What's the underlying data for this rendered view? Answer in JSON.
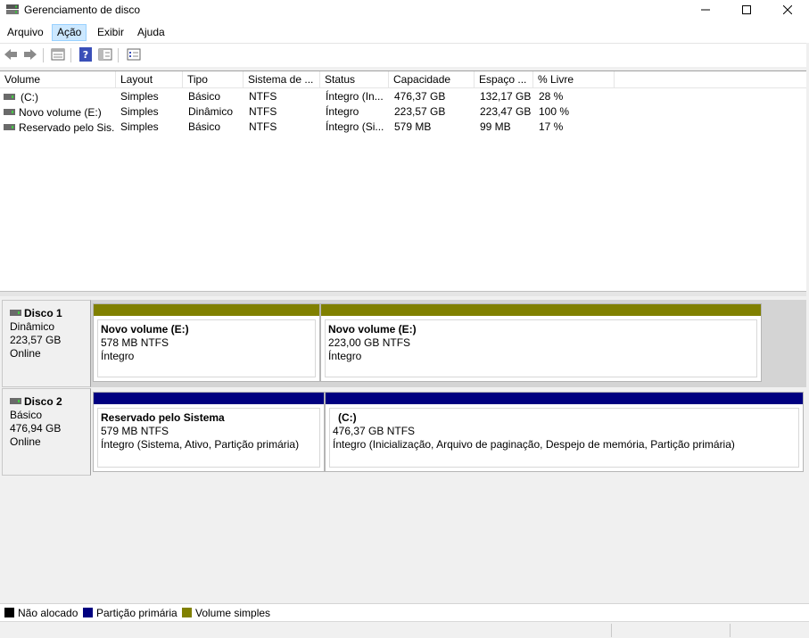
{
  "window": {
    "title": "Gerenciamento de disco",
    "controls": {
      "minimize": "—",
      "maximize": "☐",
      "close": "✕"
    }
  },
  "menu": [
    "Arquivo",
    "Ação",
    "Exibir",
    "Ajuda"
  ],
  "toolbar": [
    "back-icon",
    "forward-icon",
    "properties-icon",
    "help-icon",
    "show-hide-icon",
    "list-icon"
  ],
  "columns": [
    "Volume",
    "Layout",
    "Tipo",
    "Sistema de ...",
    "Status",
    "Capacidade",
    "Espaço ...",
    "% Livre"
  ],
  "volumes": [
    {
      "name": "(C:)",
      "layout": "Simples",
      "type": "Básico",
      "fs": "NTFS",
      "status": "Íntegro (In...",
      "capacity": "476,37 GB",
      "free": "132,17 GB",
      "pct": "28 %"
    },
    {
      "name": "Novo volume (E:)",
      "layout": "Simples",
      "type": "Dinâmico",
      "fs": "NTFS",
      "status": "Íntegro",
      "capacity": "223,57 GB",
      "free": "223,47 GB",
      "pct": "100 %"
    },
    {
      "name": "Reservado pelo Sis...",
      "layout": "Simples",
      "type": "Básico",
      "fs": "NTFS",
      "status": "Íntegro (Si...",
      "capacity": "579 MB",
      "free": "99 MB",
      "pct": "17 %"
    }
  ],
  "disks": [
    {
      "name": "Disco 1",
      "type": "Dinâmico",
      "size": "223,57 GB",
      "state": "Online",
      "partitions": [
        {
          "name": "Novo volume  (E:)",
          "size": "578 MB NTFS",
          "status": "Íntegro"
        },
        {
          "name": "Novo volume  (E:)",
          "size": "223,00 GB NTFS",
          "status": "Íntegro"
        }
      ]
    },
    {
      "name": "Disco 2",
      "type": "Básico",
      "size": "476,94 GB",
      "state": "Online",
      "partitions": [
        {
          "name": "Reservado pelo Sistema",
          "size": "579 MB NTFS",
          "status": "Íntegro (Sistema, Ativo, Partição primária)"
        },
        {
          "name": "(C:)",
          "size": "476,37 GB NTFS",
          "status": "Íntegro (Inicialização, Arquivo de paginação, Despejo de memória, Partição primária)"
        }
      ]
    }
  ],
  "legend": [
    {
      "label": "Não alocado",
      "color": "#000000"
    },
    {
      "label": "Partição primária",
      "color": "#000080"
    },
    {
      "label": "Volume simples",
      "color": "#808000"
    }
  ],
  "colors": {
    "simple_volume": "#808000",
    "primary_partition": "#000080",
    "unallocated": "#000000"
  }
}
